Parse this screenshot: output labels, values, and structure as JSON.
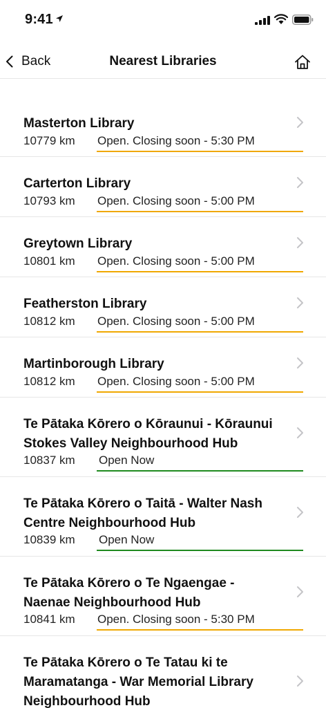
{
  "status_bar": {
    "time": "9:41"
  },
  "nav": {
    "back_label": "Back",
    "title": "Nearest Libraries"
  },
  "colors": {
    "closing_soon": "#f0a800",
    "open_now": "#1f8a1f"
  },
  "libraries": [
    {
      "name": "Masterton Library",
      "distance": "10779 km",
      "status": "Open. Closing soon - 5:30 PM",
      "status_type": "closing"
    },
    {
      "name": "Carterton Library",
      "distance": "10793 km",
      "status": "Open. Closing soon - 5:00 PM",
      "status_type": "closing"
    },
    {
      "name": "Greytown Library",
      "distance": "10801 km",
      "status": "Open. Closing soon - 5:00 PM",
      "status_type": "closing"
    },
    {
      "name": "Featherston Library",
      "distance": "10812 km",
      "status": "Open. Closing soon - 5:00 PM",
      "status_type": "closing"
    },
    {
      "name": "Martinborough Library",
      "distance": "10812 km",
      "status": "Open. Closing soon - 5:00 PM",
      "status_type": "closing"
    },
    {
      "name": "Te Pātaka Kōrero o Kōraunui - Kōraunui Stokes Valley Neighbourhood Hub",
      "distance": "10837 km",
      "status": "Open Now",
      "status_type": "open"
    },
    {
      "name": "Te Pātaka Kōrero o Taitā - Walter Nash Centre Neighbourhood Hub",
      "distance": "10839 km",
      "status": "Open Now",
      "status_type": "open"
    },
    {
      "name": "Te Pātaka Kōrero o Te Ngaengae - Naenae Neighbourhood Hub",
      "distance": "10841 km",
      "status": "Open. Closing soon - 5:30 PM",
      "status_type": "closing"
    },
    {
      "name": "Te Pātaka Kōrero o Te Tatau ki te Maramatanga - War Memorial Library Neighbourhood Hub"
    }
  ]
}
